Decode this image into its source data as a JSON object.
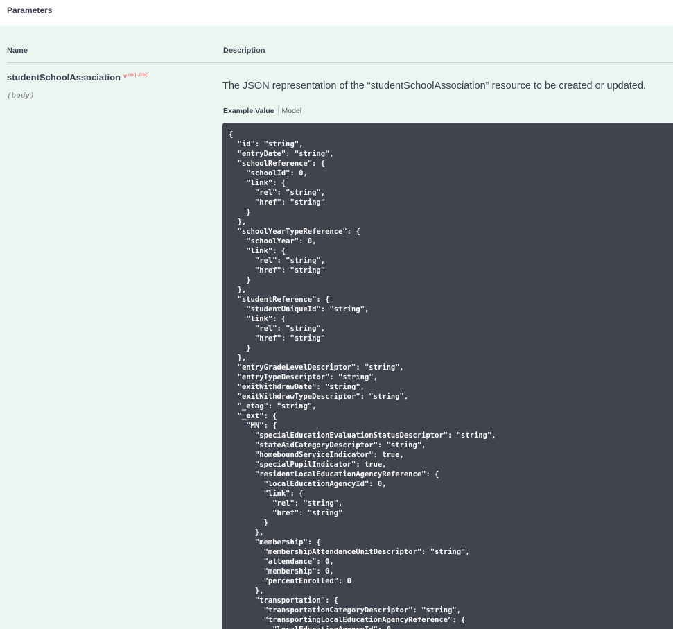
{
  "section": {
    "title": "Parameters"
  },
  "table": {
    "col_name": "Name",
    "col_description": "Description"
  },
  "parameter": {
    "name": "studentSchoolAssociation",
    "required_star": "*",
    "required_label": "required",
    "in": "(body)",
    "description": "The JSON representation of the “studentSchoolAssociation” resource to be created or updated."
  },
  "tabs": {
    "example_value": "Example Value",
    "model": "Model"
  },
  "example_json": "{\n  \"id\": \"string\",\n  \"entryDate\": \"string\",\n  \"schoolReference\": {\n    \"schoolId\": 0,\n    \"link\": {\n      \"rel\": \"string\",\n      \"href\": \"string\"\n    }\n  },\n  \"schoolYearTypeReference\": {\n    \"schoolYear\": 0,\n    \"link\": {\n      \"rel\": \"string\",\n      \"href\": \"string\"\n    }\n  },\n  \"studentReference\": {\n    \"studentUniqueId\": \"string\",\n    \"link\": {\n      \"rel\": \"string\",\n      \"href\": \"string\"\n    }\n  },\n  \"entryGradeLevelDescriptor\": \"string\",\n  \"entryTypeDescriptor\": \"string\",\n  \"exitWithdrawDate\": \"string\",\n  \"exitWithdrawTypeDescriptor\": \"string\",\n  \"_etag\": \"string\",\n  \"_ext\": {\n    \"MN\": {\n      \"specialEducationEvaluationStatusDescriptor\": \"string\",\n      \"stateAidCategoryDescriptor\": \"string\",\n      \"homeboundServiceIndicator\": true,\n      \"specialPupilIndicator\": true,\n      \"residentLocalEducationAgencyReference\": {\n        \"localEducationAgencyId\": 0,\n        \"link\": {\n          \"rel\": \"string\",\n          \"href\": \"string\"\n        }\n      },\n      \"membership\": {\n        \"membershipAttendanceUnitDescriptor\": \"string\",\n        \"attendance\": 0,\n        \"membership\": 0,\n        \"percentEnrolled\": 0\n      },\n      \"transportation\": {\n        \"transportationCategoryDescriptor\": \"string\",\n        \"transportingLocalEducationAgencyReference\": {\n          \"localEducationAgencyId\": 0,"
}
